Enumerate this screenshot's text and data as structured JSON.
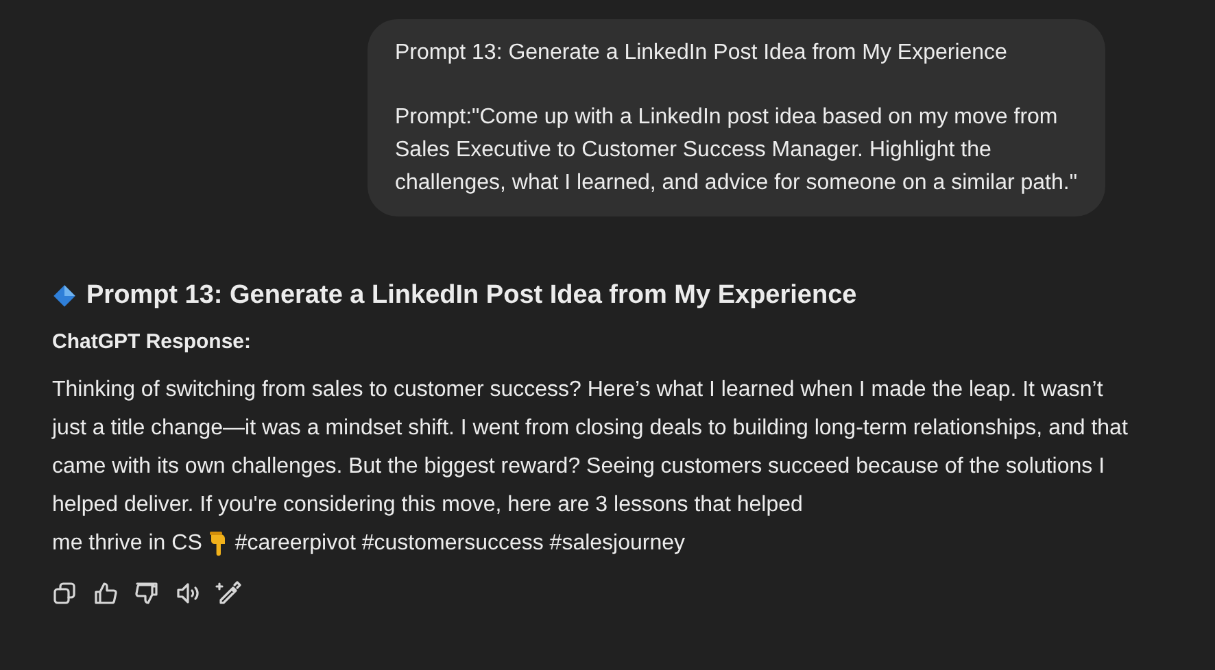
{
  "user_message": {
    "title": "Prompt 13: Generate a LinkedIn Post Idea from My Experience",
    "prompt": "Prompt:\"Come up with a LinkedIn post idea based on my move from Sales Executive to Customer Success Manager. Highlight the challenges, what I learned, and advice for someone on a similar path.\""
  },
  "response": {
    "heading": "Prompt 13: Generate a LinkedIn Post Idea from My Experience",
    "label": "ChatGPT Response:",
    "body": "Thinking of switching from sales to customer success? Here’s what I learned when I made the leap. It wasn’t just a title change—it was a mindset shift. I went from closing deals to building long-term relationships, and that came with its own challenges. But the biggest reward? Seeing customers succeed because of the solutions I helped deliver. If you're considering this move, here are 3 lessons that helped",
    "body_end": "me thrive in CS",
    "hashtags": "#careerpivot #customersuccess #salesjourney"
  },
  "actions": [
    {
      "kind": "copy"
    },
    {
      "kind": "like"
    },
    {
      "kind": "dislike"
    },
    {
      "kind": "read"
    },
    {
      "kind": "edit"
    }
  ]
}
